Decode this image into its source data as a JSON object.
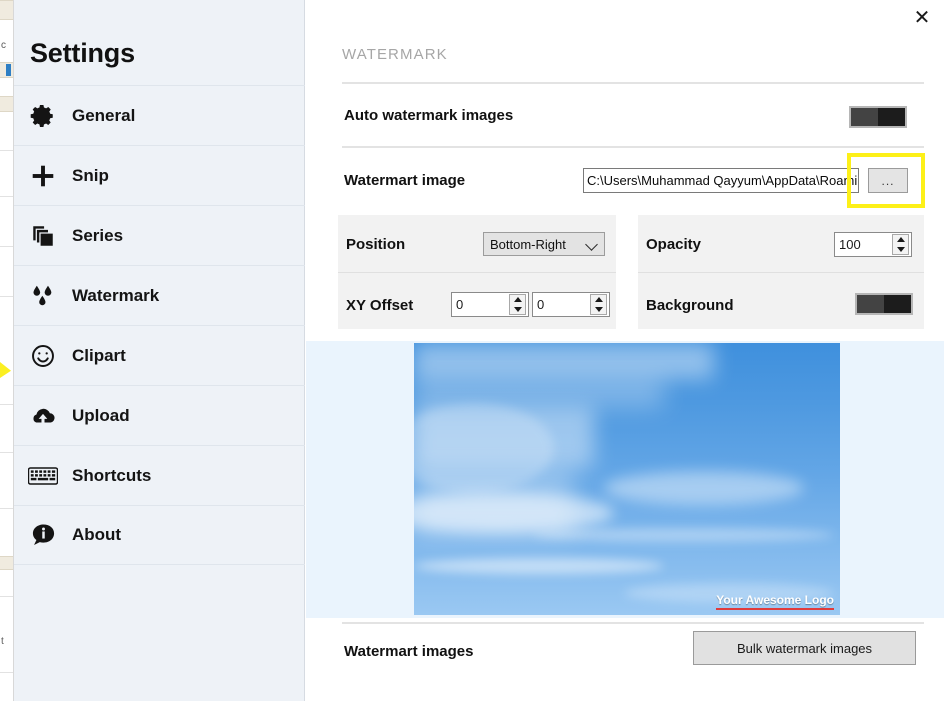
{
  "window": {
    "close_label": "✕"
  },
  "sidebar": {
    "title": "Settings",
    "items": [
      {
        "label": "General",
        "icon": "gear-icon"
      },
      {
        "label": "Snip",
        "icon": "plus-icon"
      },
      {
        "label": "Series",
        "icon": "layers-icon"
      },
      {
        "label": "Watermark",
        "icon": "droplets-icon"
      },
      {
        "label": "Clipart",
        "icon": "smiley-icon"
      },
      {
        "label": "Upload",
        "icon": "cloud-upload-icon"
      },
      {
        "label": "Shortcuts",
        "icon": "keyboard-icon"
      },
      {
        "label": "About",
        "icon": "info-bubble-icon"
      }
    ]
  },
  "main": {
    "section_title": "WATERMARK",
    "auto_watermark": {
      "label": "Auto watermark images",
      "toggle_state": "on"
    },
    "watermark_image": {
      "label": "Watermart image",
      "path_value": "C:\\Users\\Muhammad Qayyum\\AppData\\Roaming",
      "browse_label": "...",
      "browse_highlighted": true
    },
    "position": {
      "label": "Position",
      "selected": "Bottom-Right"
    },
    "xy_offset": {
      "label": "XY Offset",
      "x_value": "0",
      "y_value": "0"
    },
    "opacity": {
      "label": "Opacity",
      "value": "100"
    },
    "background": {
      "label": "Background",
      "toggle_state": "on"
    },
    "preview": {
      "watermark_text": "Your Awesome Logo",
      "alt": "sky-with-clouds-preview"
    },
    "bulk": {
      "label": "Watermart images",
      "button_label": "Bulk watermark images"
    }
  },
  "colors": {
    "sidebar_bg": "#eef2f7",
    "panel_bg": "#f2f2f2",
    "preview_bg": "#eaf4fd",
    "highlight": "#fdf018",
    "toggle_on": "#1c1c1c",
    "section_title": "#a6a6a6",
    "underline_red": "#e03b3b"
  }
}
